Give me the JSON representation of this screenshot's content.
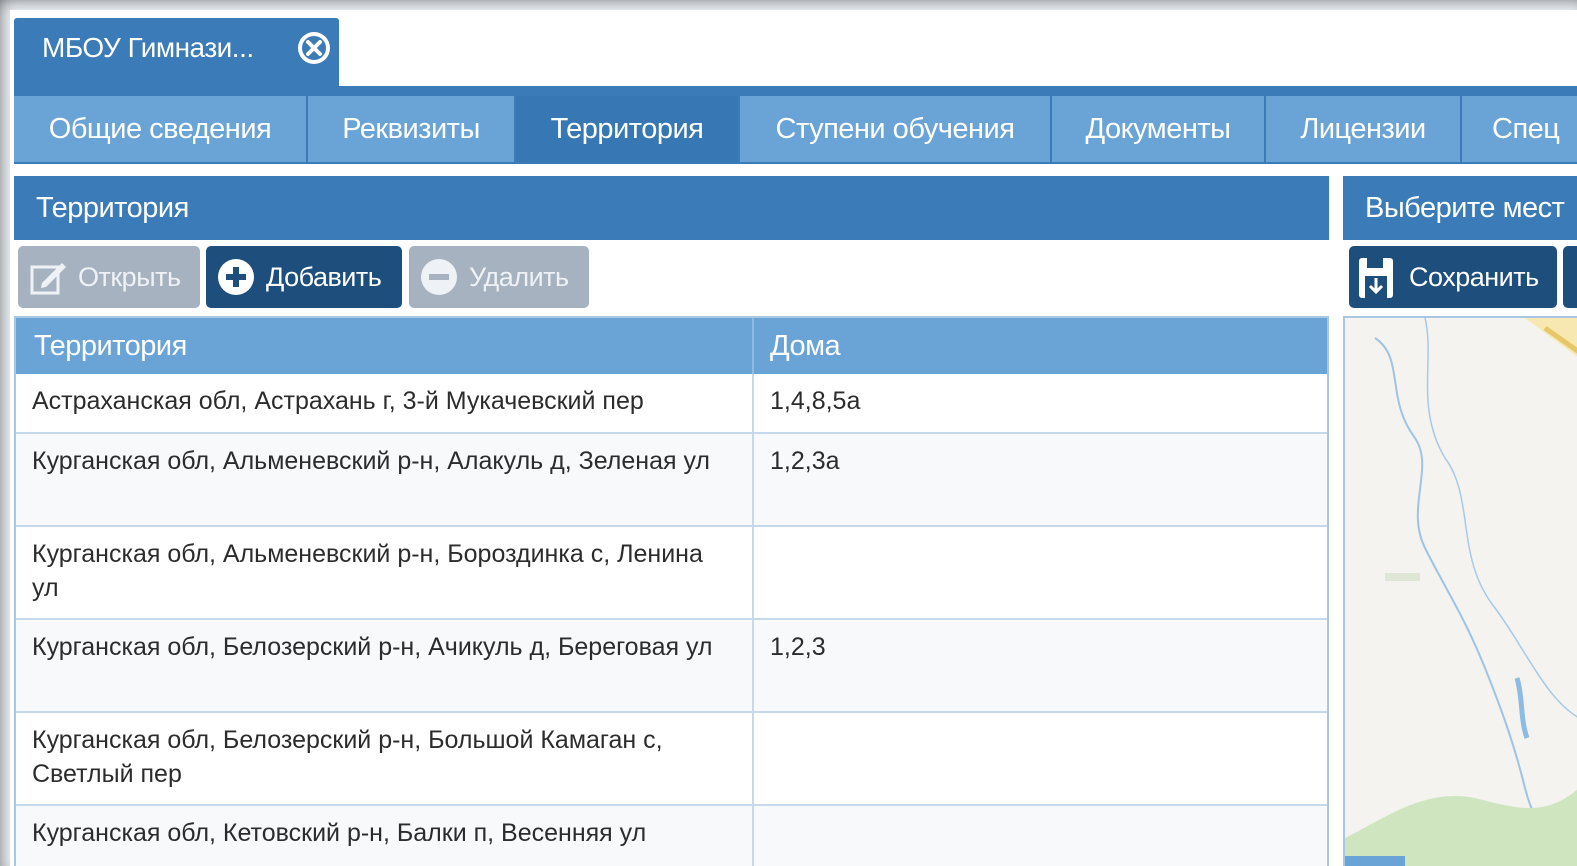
{
  "window_tab": {
    "title": "МБОУ Гимнази..."
  },
  "tabs": [
    {
      "label": "Общие сведения"
    },
    {
      "label": "Реквизиты"
    },
    {
      "label": "Территория"
    },
    {
      "label": "Ступени обучения"
    },
    {
      "label": "Документы"
    },
    {
      "label": "Лицензии"
    },
    {
      "label": "Спец"
    }
  ],
  "active_tab": "Территория",
  "left_panel": {
    "title": "Территория",
    "toolbar": {
      "open_label": "Открыть",
      "add_label": "Добавить",
      "delete_label": "Удалить"
    },
    "table": {
      "columns": [
        "Территория",
        "Дома"
      ],
      "rows": [
        {
          "territory": "Астраханская обл, Астрахань г, 3-й Мукачевский пер",
          "houses": "1,4,8,5а"
        },
        {
          "territory": "Курганская обл, Альменевский р-н, Алакуль д, Зеленая ул",
          "houses": "1,2,3а"
        },
        {
          "territory": "Курганская обл, Альменевский р-н, Бороздинка с, Ленина ул",
          "houses": ""
        },
        {
          "territory": "Курганская обл, Белозерский р-н, Ачикуль д, Береговая ул",
          "houses": "1,2,3"
        },
        {
          "territory": "Курганская обл, Белозерский р-н, Большой Камаган с, Светлый пер",
          "houses": ""
        },
        {
          "territory": "Курганская обл, Кетовский р-н, Балки п, Весенняя ул",
          "houses": ""
        }
      ]
    }
  },
  "right_panel": {
    "title": "Выберите мест",
    "save_label": "Сохранить"
  },
  "colors": {
    "header_blue": "#3b7bb7",
    "tab_blue": "#6aa3d6",
    "button_dark": "#1d4e7c",
    "button_disabled": "#a6b2bf"
  }
}
